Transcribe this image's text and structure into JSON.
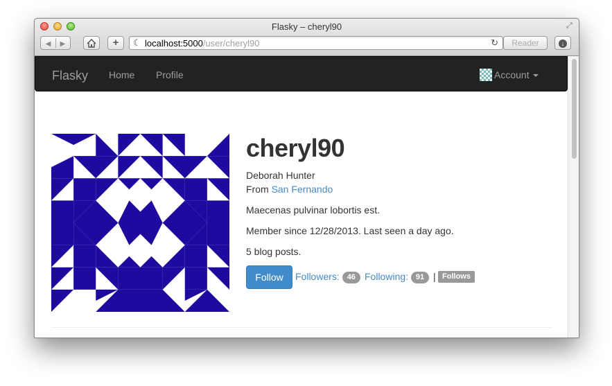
{
  "window": {
    "title": "Flasky – cheryl90"
  },
  "toolbar": {
    "url_host": "localhost:5000",
    "url_path": "/user/cheryl90",
    "reader_label": "Reader",
    "add_label": "+"
  },
  "navbar": {
    "brand": "Flasky",
    "links": [
      {
        "label": "Home"
      },
      {
        "label": "Profile"
      }
    ],
    "account_label": "Account"
  },
  "profile": {
    "username": "cheryl90",
    "real_name": "Deborah Hunter",
    "from_label": "From",
    "location": "San Fernando",
    "about": "Maecenas pulvinar lobortis est.",
    "member_since": "Member since 12/28/2013. Last seen a day ago.",
    "posts": "5 blog posts.",
    "follow_button": "Follow",
    "followers_label": "Followers:",
    "followers_count": "46",
    "following_label": "Following:",
    "following_count": "91",
    "separator": "|",
    "follows_you": "Follows you"
  },
  "colors": {
    "identicon": "#1f0aa0",
    "navbar_bg": "#222222",
    "link": "#428bca",
    "badge": "#999999"
  },
  "icons": [
    "back-icon",
    "forward-icon",
    "home-icon",
    "favicon-icon",
    "reload-icon",
    "download-icon",
    "resize-icon",
    "caret-down-icon",
    "account-avatar-icon"
  ]
}
